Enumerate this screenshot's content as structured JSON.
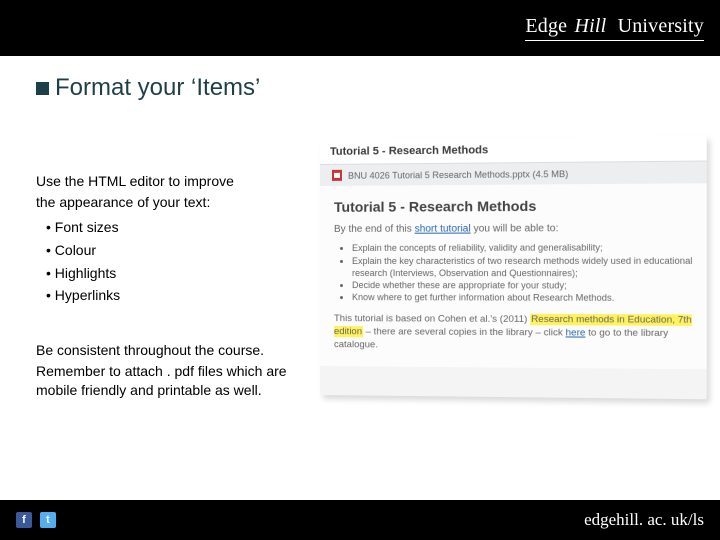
{
  "brand": {
    "edge": "Edge",
    "hill": "Hill",
    "univ": "University"
  },
  "title": "Format your ‘Items’",
  "left": {
    "intro1": "Use the HTML editor to improve",
    "intro2": "the appearance of your text:",
    "bullets": [
      "Font sizes",
      "Colour",
      "Highlights",
      "Hyperlinks"
    ],
    "para3": "Be consistent throughout the course.",
    "para4": "Remember to attach . pdf files which are mobile friendly and printable as well."
  },
  "preview": {
    "header": "Tutorial 5 - Research Methods",
    "attachment_label": "BNU 4026 Tutorial 5 Research Methods.pptx (4.5 MB)",
    "body_heading": "Tutorial 5 - Research Methods",
    "lead_1": "By the end of this ",
    "lead_link": "short tutorial",
    "lead_2": " you will be able to:",
    "items": [
      "Explain the concepts of reliability, validity and generalisability;",
      "Explain the key characteristics of two research methods widely used in educational research (Interviews, Observation and Questionnaires);",
      "Decide whether these are appropriate for your study;",
      "Know where to get further information about Research Methods."
    ],
    "para_pre": "This tutorial is based on Cohen et al.'s (2011) ",
    "para_hl": "Research methods in Education, 7th edition",
    "para_post1": " – there are several copies in the library – click ",
    "para_link": "here",
    "para_post2": " to go to the library catalogue."
  },
  "footer": {
    "url": "edgehill. ac. uk/ls"
  }
}
